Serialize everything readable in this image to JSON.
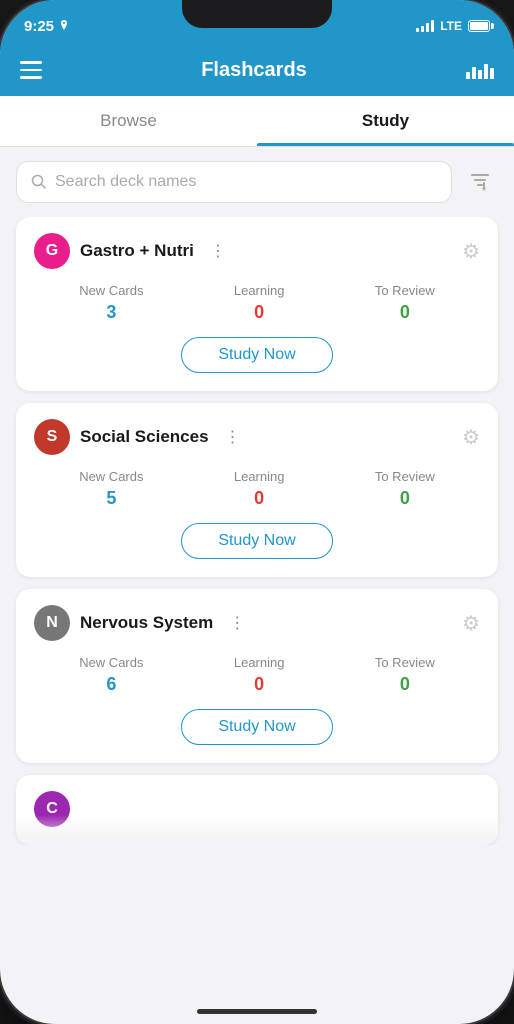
{
  "statusBar": {
    "time": "9:25",
    "lte": "LTE"
  },
  "header": {
    "title": "Flashcards",
    "menuIcon": "hamburger-icon",
    "chartIcon": "chart-icon"
  },
  "tabs": [
    {
      "id": "browse",
      "label": "Browse",
      "active": false
    },
    {
      "id": "study",
      "label": "Study",
      "active": true
    }
  ],
  "search": {
    "placeholder": "Search deck names"
  },
  "decks": [
    {
      "id": "gastro",
      "initial": "G",
      "name": "Gastro + Nutri",
      "avatarColor": "#e91e8c",
      "newCards": 3,
      "learning": 0,
      "toReview": 0,
      "studyNowLabel": "Study Now"
    },
    {
      "id": "social",
      "initial": "S",
      "name": "Social Sciences",
      "avatarColor": "#c0392b",
      "newCards": 5,
      "learning": 0,
      "toReview": 0,
      "studyNowLabel": "Study Now"
    },
    {
      "id": "nervous",
      "initial": "N",
      "name": "Nervous System",
      "avatarColor": "#777",
      "newCards": 6,
      "learning": 0,
      "toReview": 0,
      "studyNowLabel": "Study Now"
    }
  ],
  "partialDeck": {
    "initial": "C",
    "avatarColor": "#9c27b0"
  },
  "labels": {
    "newCards": "New Cards",
    "learning": "Learning",
    "toReview": "To Review"
  }
}
